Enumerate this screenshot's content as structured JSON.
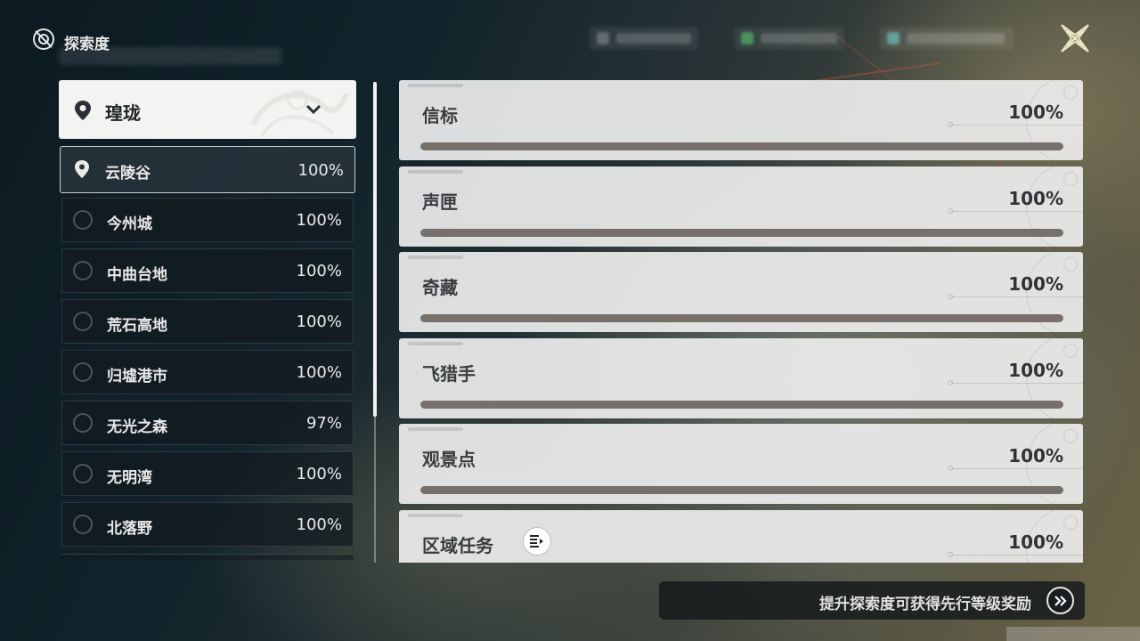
{
  "header": {
    "title": "探索度"
  },
  "region": {
    "name": "瑝珑"
  },
  "areas": [
    {
      "name": "云陵谷",
      "percent": "100%"
    },
    {
      "name": "今州城",
      "percent": "100%"
    },
    {
      "name": "中曲台地",
      "percent": "100%"
    },
    {
      "name": "荒石高地",
      "percent": "100%"
    },
    {
      "name": "归墟港市",
      "percent": "100%"
    },
    {
      "name": "无光之森",
      "percent": "97%"
    },
    {
      "name": "无明湾",
      "percent": "100%"
    },
    {
      "name": "北落野",
      "percent": "100%"
    }
  ],
  "categories": [
    {
      "name": "信标",
      "percent": "100%",
      "progress": 1.0
    },
    {
      "name": "声匣",
      "percent": "100%",
      "progress": 1.0
    },
    {
      "name": "奇藏",
      "percent": "100%",
      "progress": 1.0
    },
    {
      "name": "飞猎手",
      "percent": "100%",
      "progress": 1.0
    },
    {
      "name": "观景点",
      "percent": "100%",
      "progress": 1.0
    },
    {
      "name": "区域任务",
      "percent": "100%",
      "progress": 1.0
    }
  ],
  "hint": {
    "text": "提升探索度可获得先行等级奖励"
  },
  "colors": {
    "card_bg": "#ececec",
    "progress_fill": "#77706a",
    "panel_dark": "#121a20",
    "accent_gold": "#e8e0c0"
  },
  "icons": {
    "header": "compass-icon",
    "close": "close-icon",
    "region": "location-pin-icon",
    "dropdown": "chevron-down-icon",
    "quest": "quest-list-icon",
    "hint_go": "double-chevron-right-icon"
  }
}
